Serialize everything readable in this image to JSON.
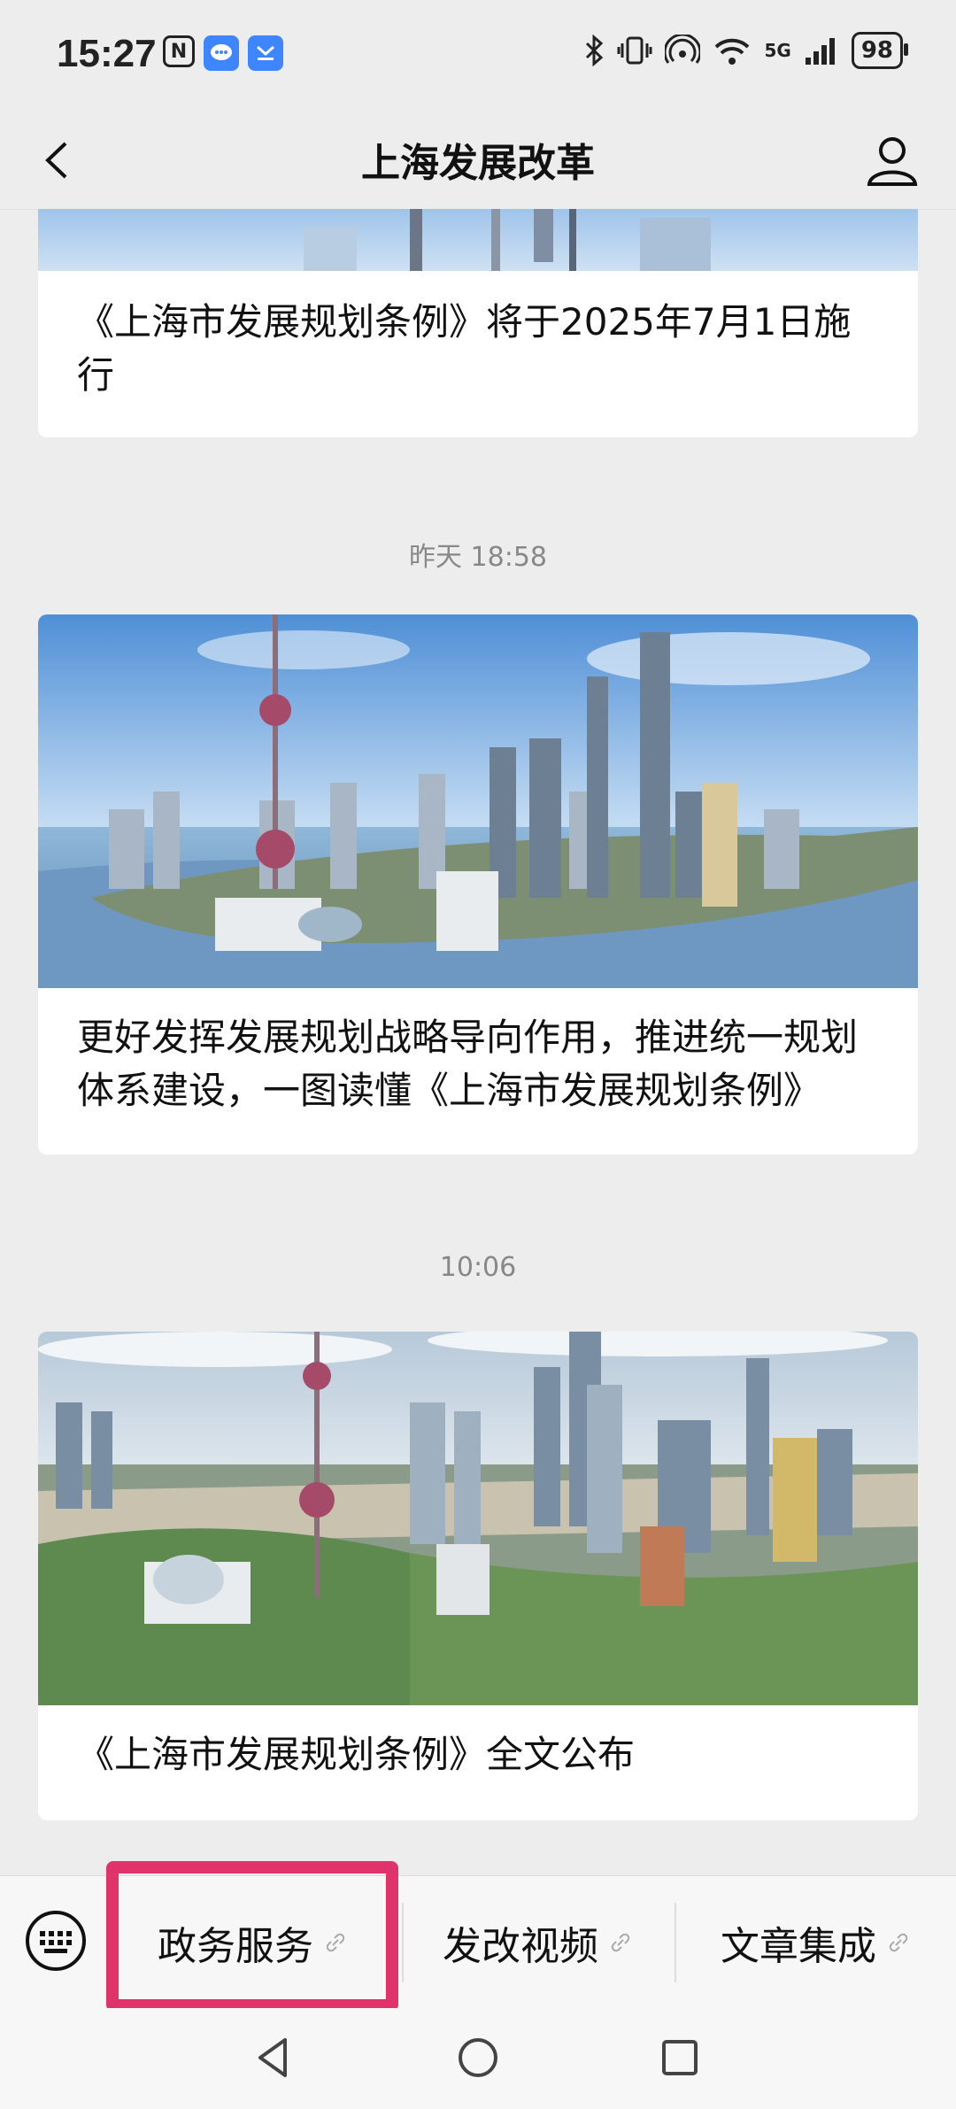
{
  "status_bar": {
    "time": "15:27",
    "battery": "98",
    "network": "5G",
    "icons": [
      "nfc-icon",
      "message-icon",
      "honor-store-icon",
      "bluetooth-icon",
      "vibrate-icon",
      "hotspot-icon",
      "wifi-icon",
      "signal-icon",
      "battery-icon"
    ]
  },
  "header": {
    "title": "上海发展改革"
  },
  "articles": [
    {
      "caption": "《上海市发展规划条例》将于2025年7月1日施行"
    },
    {
      "timestamp": "昨天 18:58",
      "caption": "更好发挥发展规划战略导向作用，推进统一规划体系建设，一图读懂《上海市发展规划条例》"
    },
    {
      "timestamp": "10:06",
      "caption": "《上海市发展规划条例》全文公布"
    }
  ],
  "menu": {
    "items": [
      {
        "label": "政务服务"
      },
      {
        "label": "发改视频"
      },
      {
        "label": "文章集成"
      }
    ]
  },
  "colors": {
    "background": "#ededed",
    "highlight": "#e0336b",
    "accent": "#3d86ff"
  }
}
